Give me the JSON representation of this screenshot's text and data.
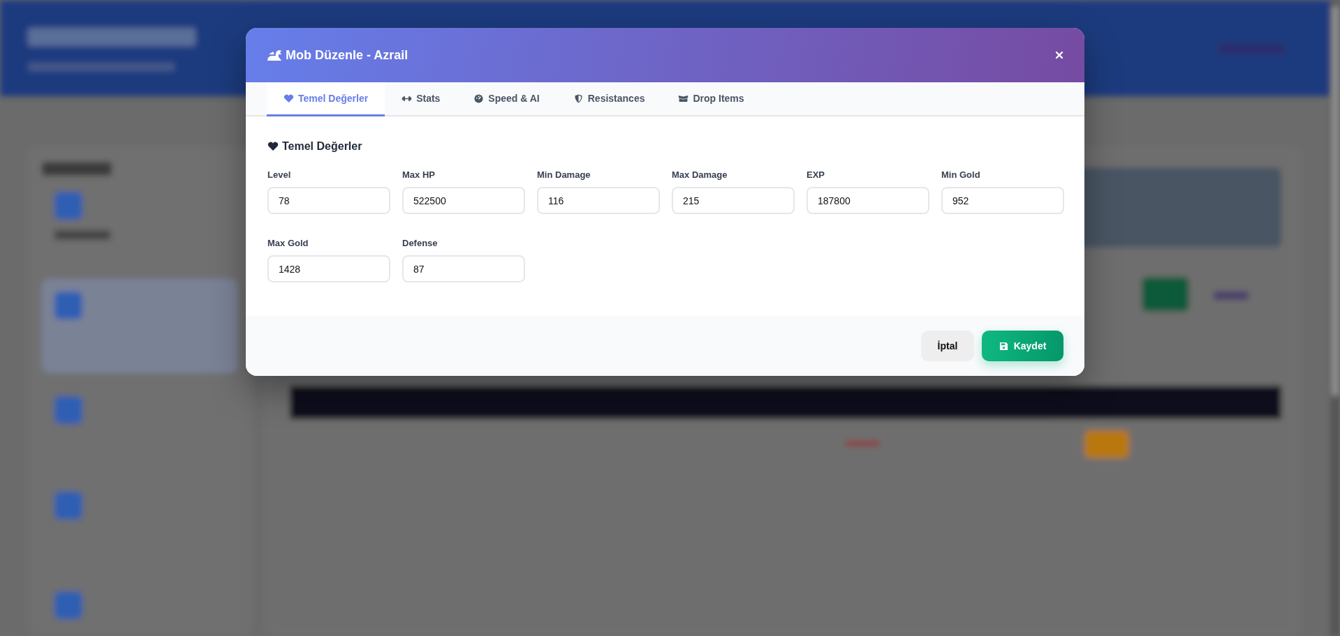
{
  "modal": {
    "title": "Mob Düzenle - Azrail"
  },
  "tabs": [
    {
      "label": "Temel Değerler",
      "selected": true
    },
    {
      "label": "Stats",
      "selected": false
    },
    {
      "label": "Speed & AI",
      "selected": false
    },
    {
      "label": "Resistances",
      "selected": false
    },
    {
      "label": "Drop Items",
      "selected": false
    }
  ],
  "section": {
    "title": "Temel Değerler"
  },
  "fields": [
    {
      "label": "Level",
      "value": "78"
    },
    {
      "label": "Max HP",
      "value": "522500"
    },
    {
      "label": "Min Damage",
      "value": "116"
    },
    {
      "label": "Max Damage",
      "value": "215"
    },
    {
      "label": "EXP",
      "value": "187800"
    },
    {
      "label": "Min Gold",
      "value": "952"
    },
    {
      "label": "Max Gold",
      "value": "1428"
    },
    {
      "label": "Defense",
      "value": "87"
    }
  ],
  "buttons": {
    "cancel": "İptal",
    "save": "Kaydet"
  }
}
